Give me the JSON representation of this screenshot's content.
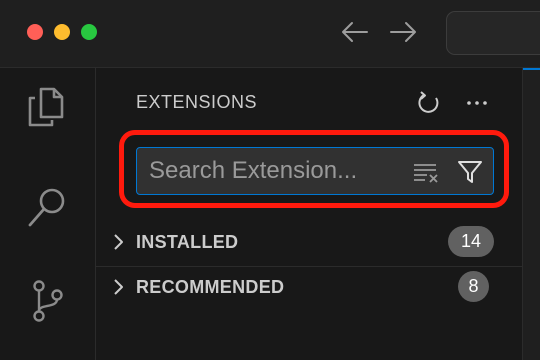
{
  "sidebar": {
    "title": "EXTENSIONS",
    "search": {
      "placeholder": "Search Extension...",
      "value": ""
    },
    "sections": [
      {
        "label": "INSTALLED",
        "count": "14",
        "expanded": false
      },
      {
        "label": "RECOMMENDED",
        "count": "8",
        "expanded": false
      }
    ]
  },
  "icons": {
    "window_controls": [
      "close-icon",
      "minimize-icon",
      "maximize-icon"
    ],
    "navigation": [
      "arrow-left-icon",
      "arrow-right-icon"
    ],
    "activity_bar": [
      "files-icon",
      "search-icon",
      "source-control-icon"
    ],
    "sidebar_actions": [
      "refresh-icon",
      "more-icon"
    ],
    "search_actions": [
      "clear-filter-icon",
      "filter-icon"
    ]
  },
  "colors": {
    "highlight": "#ff1a0d",
    "focus_border": "#0078d4",
    "badge": "#616161"
  }
}
